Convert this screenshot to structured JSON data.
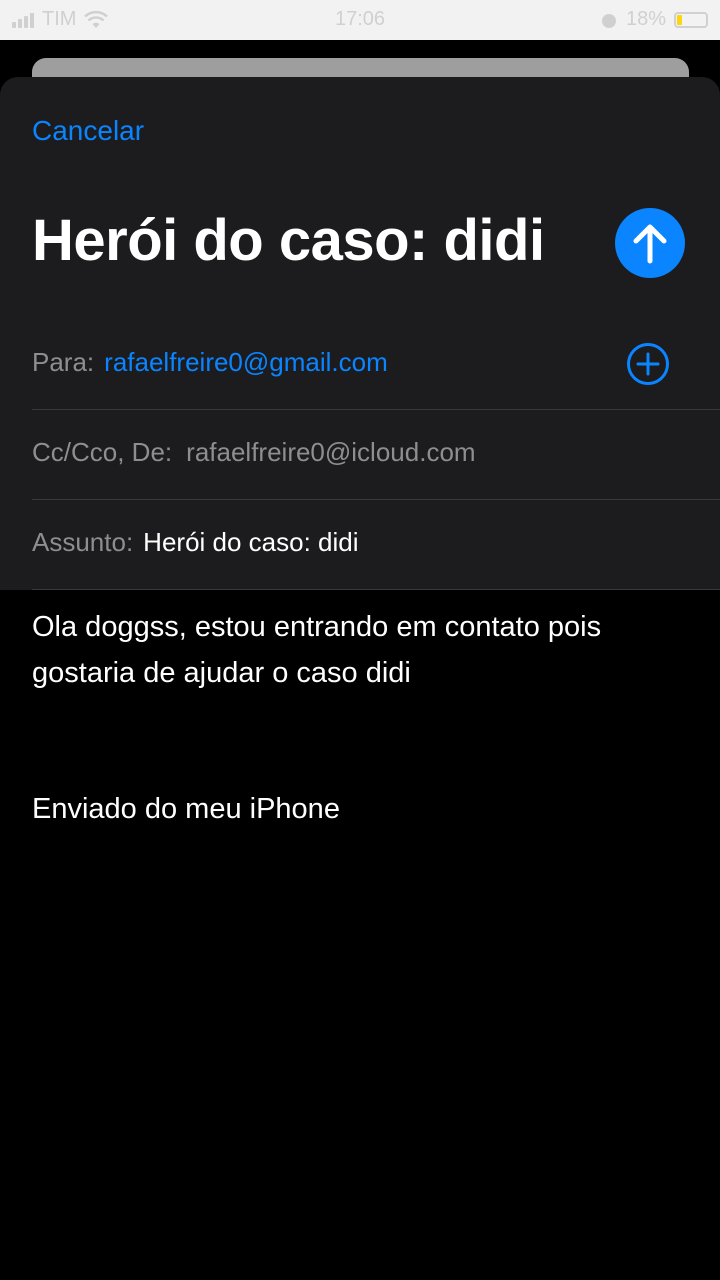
{
  "status_bar": {
    "carrier": "TIM",
    "time": "17:06",
    "battery_percent": "18%",
    "battery_level": 0.18,
    "battery_color": "#ffd60a"
  },
  "compose": {
    "cancel_label": "Cancelar",
    "title": "Herói do caso: didi",
    "send_icon": "arrow-up-icon",
    "add_icon": "plus-circle-icon",
    "to_label": "Para:",
    "to_value": "rafaelfreire0@gmail.com",
    "cc_label": "Cc/Cco, De:",
    "cc_value": "rafaelfreire0@icloud.com",
    "subject_label": "Assunto:",
    "subject_value": "Herói do caso: didi",
    "body": "Ola doggss, estou entrando em contato pois gostaria de ajudar o caso didi",
    "signature": "Enviado do meu iPhone"
  },
  "colors": {
    "accent": "#0a84ff",
    "sheet_bg": "#1c1c1e",
    "body_bg": "#000000"
  }
}
